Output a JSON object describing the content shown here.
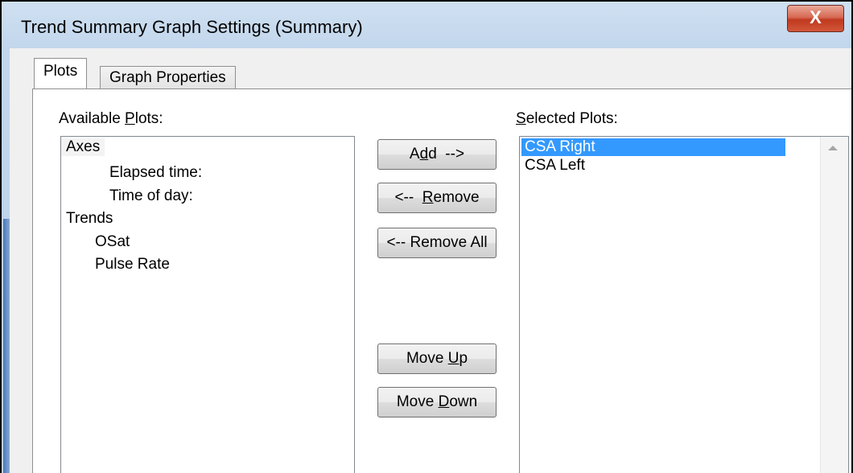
{
  "window": {
    "title": "Trend Summary Graph Settings (Summary)",
    "close_label": "X"
  },
  "tabs": [
    {
      "label": "Plots",
      "active": true
    },
    {
      "label": "Graph Properties",
      "active": false
    }
  ],
  "available": {
    "label_pre": "Available ",
    "label_mn": "P",
    "label_post": "lots:",
    "items": [
      {
        "text": "Axes",
        "indent": 0
      },
      {
        "text": "Elapsed time:",
        "indent": 2
      },
      {
        "text": "Time of day:",
        "indent": 2
      },
      {
        "text": "Trends",
        "indent": 0
      },
      {
        "text": "OSat",
        "indent": 1
      },
      {
        "text": "Pulse Rate",
        "indent": 1
      }
    ]
  },
  "buttons": {
    "add": {
      "pre": "A",
      "mn": "d",
      "post": "d  -->"
    },
    "remove": {
      "pre": "<--  ",
      "mn": "R",
      "post": "emove"
    },
    "remove_all": {
      "pre": "<-- Remove All",
      "mn": "",
      "post": ""
    },
    "move_up": {
      "pre": "Move ",
      "mn": "U",
      "post": "p"
    },
    "move_down": {
      "pre": "Move ",
      "mn": "D",
      "post": "own"
    }
  },
  "selected": {
    "label_mn": "S",
    "label_post": "elected Plots:",
    "items": [
      {
        "text": "CSA Right",
        "selected": true
      },
      {
        "text": "CSA Left",
        "selected": false
      }
    ]
  }
}
